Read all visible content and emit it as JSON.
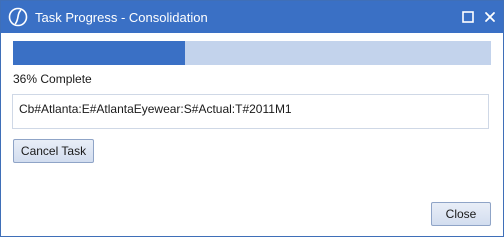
{
  "window": {
    "title": "Task Progress - Consolidation",
    "icons": {
      "logo": "app-logo-icon",
      "maximize": "maximize-icon",
      "close": "close-icon"
    }
  },
  "progress": {
    "percent": 36,
    "label": "36% Complete",
    "fill_color": "#3a70c5",
    "track_color": "#c3d3ec"
  },
  "task": {
    "detail": "Cb#Atlanta:E#AtlantaEyewear:S#Actual:T#2011M1"
  },
  "buttons": {
    "cancel_label": "Cancel Task",
    "close_label": "Close"
  },
  "colors": {
    "titlebar": "#3a70c5"
  }
}
